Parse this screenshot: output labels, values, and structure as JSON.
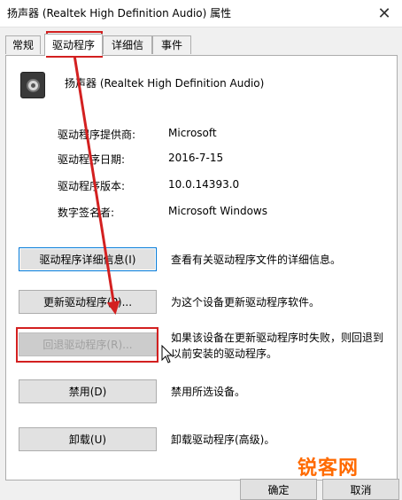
{
  "window": {
    "title": "扬声器 (Realtek High Definition Audio) 属性",
    "close_glyph": "✕"
  },
  "tabs": [
    {
      "label": "常规",
      "active": false
    },
    {
      "label": "驱动程序",
      "active": true
    },
    {
      "label": "详细信息",
      "active": false
    },
    {
      "label": "事件",
      "active": false
    }
  ],
  "device": {
    "icon": "speaker-icon",
    "name": "扬声器 (Realtek High Definition Audio)"
  },
  "info": [
    {
      "label": "驱动程序提供商:",
      "value": "Microsoft"
    },
    {
      "label": "驱动程序日期:",
      "value": "2016-7-15"
    },
    {
      "label": "驱动程序版本:",
      "value": "10.0.14393.0"
    },
    {
      "label": "数字签名者:",
      "value": "Microsoft Windows"
    }
  ],
  "actions": [
    {
      "button": "驱动程序详细信息(I)",
      "description": [
        "查看有关驱动程序文件的详细信息。"
      ]
    },
    {
      "button": "更新驱动程序(P)...",
      "description": [
        "为这个设备更新驱动程序软件。"
      ]
    },
    {
      "button": "回退驱动程序(R)...",
      "description": [
        "如果该设备在更新驱动程序时失败，则回退到",
        "以前安装的驱动程序。"
      ]
    },
    {
      "button": "禁用(D)",
      "description": [
        "禁用所选设备。"
      ]
    },
    {
      "button": "卸载(U)",
      "description": [
        "卸载驱动程序(高级)。"
      ]
    }
  ],
  "footer": {
    "ok": "确定",
    "cancel": "取消"
  },
  "watermark": "锐客网",
  "colors": {
    "annotation_red": "#d32020",
    "focus_blue": "#0078d7",
    "watermark_orange": "#ff6a00"
  }
}
